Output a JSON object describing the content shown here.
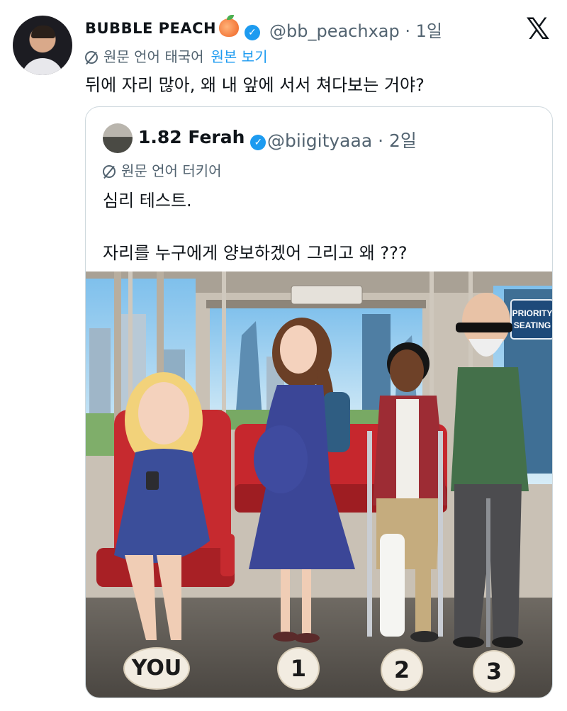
{
  "tweet": {
    "author_name": "BUBBLE PEACH",
    "author_handle": "@bb_peachxap · 1일",
    "translate_label": "원문 언어 태국어",
    "show_original_label": "원본 보기",
    "text": "뒤에 자리 많아, 왜 내 앞에 서서 쳐다보는 거야?"
  },
  "quote": {
    "author_name": "1.82 Ferah",
    "author_handle": "@biigityaaa · 2일",
    "translate_label": "원문 언어 터키어",
    "line1": "심리 테스트.",
    "line2": "자리를 누구에게 양보하겠어 그리고 왜 ???"
  },
  "illustration": {
    "sign_text": "PRIORITY SEATING",
    "labels": [
      "YOU",
      "1",
      "2",
      "3"
    ]
  },
  "icons": [
    "x-logo-icon",
    "verified-badge-icon",
    "peach-emoji-icon",
    "translate-icon"
  ],
  "colors": {
    "accent": "#1d9bf0",
    "secondary_text": "#536471",
    "border": "#cfd9de"
  }
}
